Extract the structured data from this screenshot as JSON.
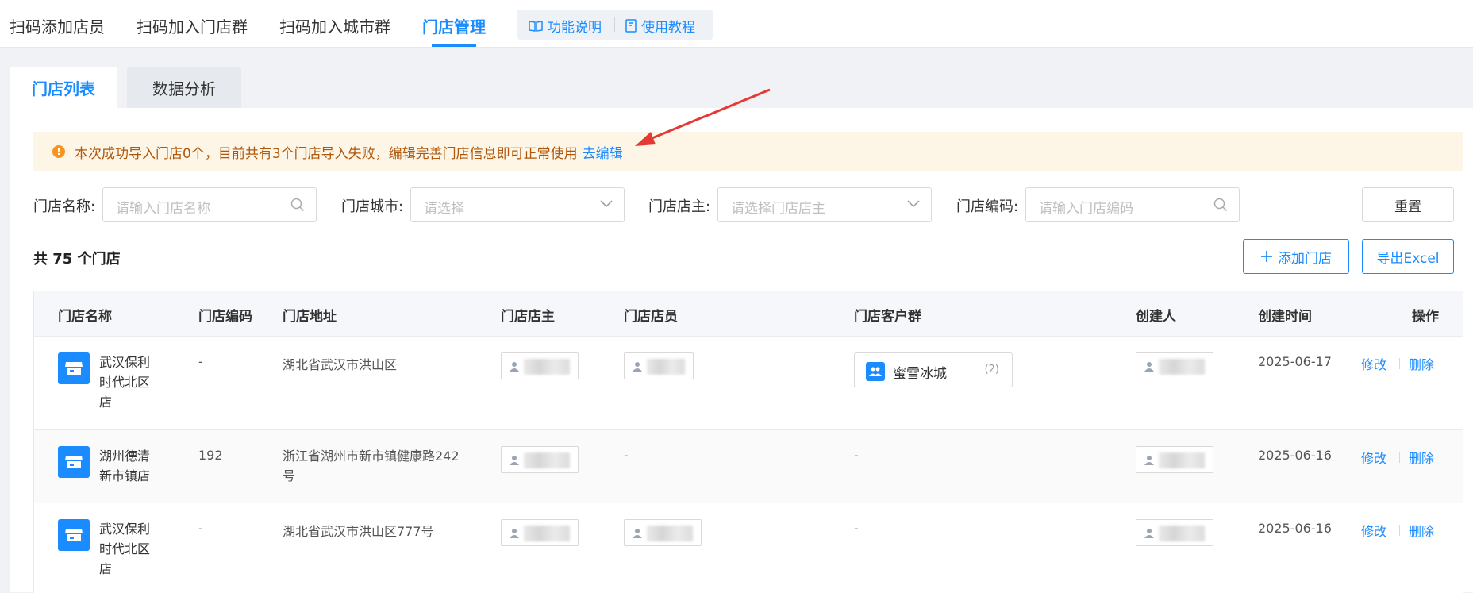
{
  "topnav": {
    "tabs": [
      {
        "label": "扫码添加店员",
        "name": "tab-scan-add-staff"
      },
      {
        "label": "扫码加入门店群",
        "name": "tab-scan-join-store-group"
      },
      {
        "label": "扫码加入城市群",
        "name": "tab-scan-join-city-group"
      },
      {
        "label": "门店管理",
        "name": "tab-store-management"
      }
    ],
    "help": {
      "feature_label": "功能说明",
      "tutorial_label": "使用教程"
    }
  },
  "subtabs": {
    "list_label": "门店列表",
    "analysis_label": "数据分析"
  },
  "alert": {
    "message": "本次成功导入门店0个，目前共有3个门店导入失败，编辑完善门店信息即可正常使用",
    "link": "去编辑"
  },
  "filters": {
    "name_label": "门店名称:",
    "name_placeholder": "请输入门店名称",
    "city_label": "门店城市:",
    "city_placeholder": "请选择",
    "owner_label": "门店店主:",
    "owner_placeholder": "请选择门店店主",
    "code_label": "门店编码:",
    "code_placeholder": "请输入门店编码",
    "reset_label": "重置"
  },
  "summary": {
    "count_text": "共 75 个门店"
  },
  "actions": {
    "add_label": "添加门店",
    "export_label": "导出Excel"
  },
  "table": {
    "headers": {
      "name": "门店名称",
      "code": "门店编码",
      "address": "门店地址",
      "owner": "门店店主",
      "staff": "门店店员",
      "groups": "门店客户群",
      "creator": "创建人",
      "created": "创建时间",
      "ops": "操作"
    },
    "rows": [
      {
        "name": "武汉保利时代北区店",
        "code": "-",
        "address": "湖北省武汉市洪山区",
        "staff_text": "",
        "group_name": "蜜雪冰城",
        "group_count": "(2)",
        "created": "2025-06-17",
        "edit": "修改",
        "delete": "删除"
      },
      {
        "name": "湖州德清新市镇店",
        "code": "192",
        "address": "浙江省湖州市新市镇健康路242号",
        "staff_text": "-",
        "group_text": "-",
        "created": "2025-06-16",
        "edit": "修改",
        "delete": "删除"
      },
      {
        "name": "武汉保利时代北区店",
        "code": "-",
        "address": "湖北省武汉市洪山区777号",
        "staff_text": "",
        "group_text": "-",
        "created": "2025-06-16",
        "edit": "修改",
        "delete": "删除"
      }
    ]
  },
  "colors": {
    "accent": "#1a8cff",
    "alert_bg": "#fdf5e6",
    "alert_text": "#b0570b",
    "annotation_arrow": "#e53935"
  }
}
